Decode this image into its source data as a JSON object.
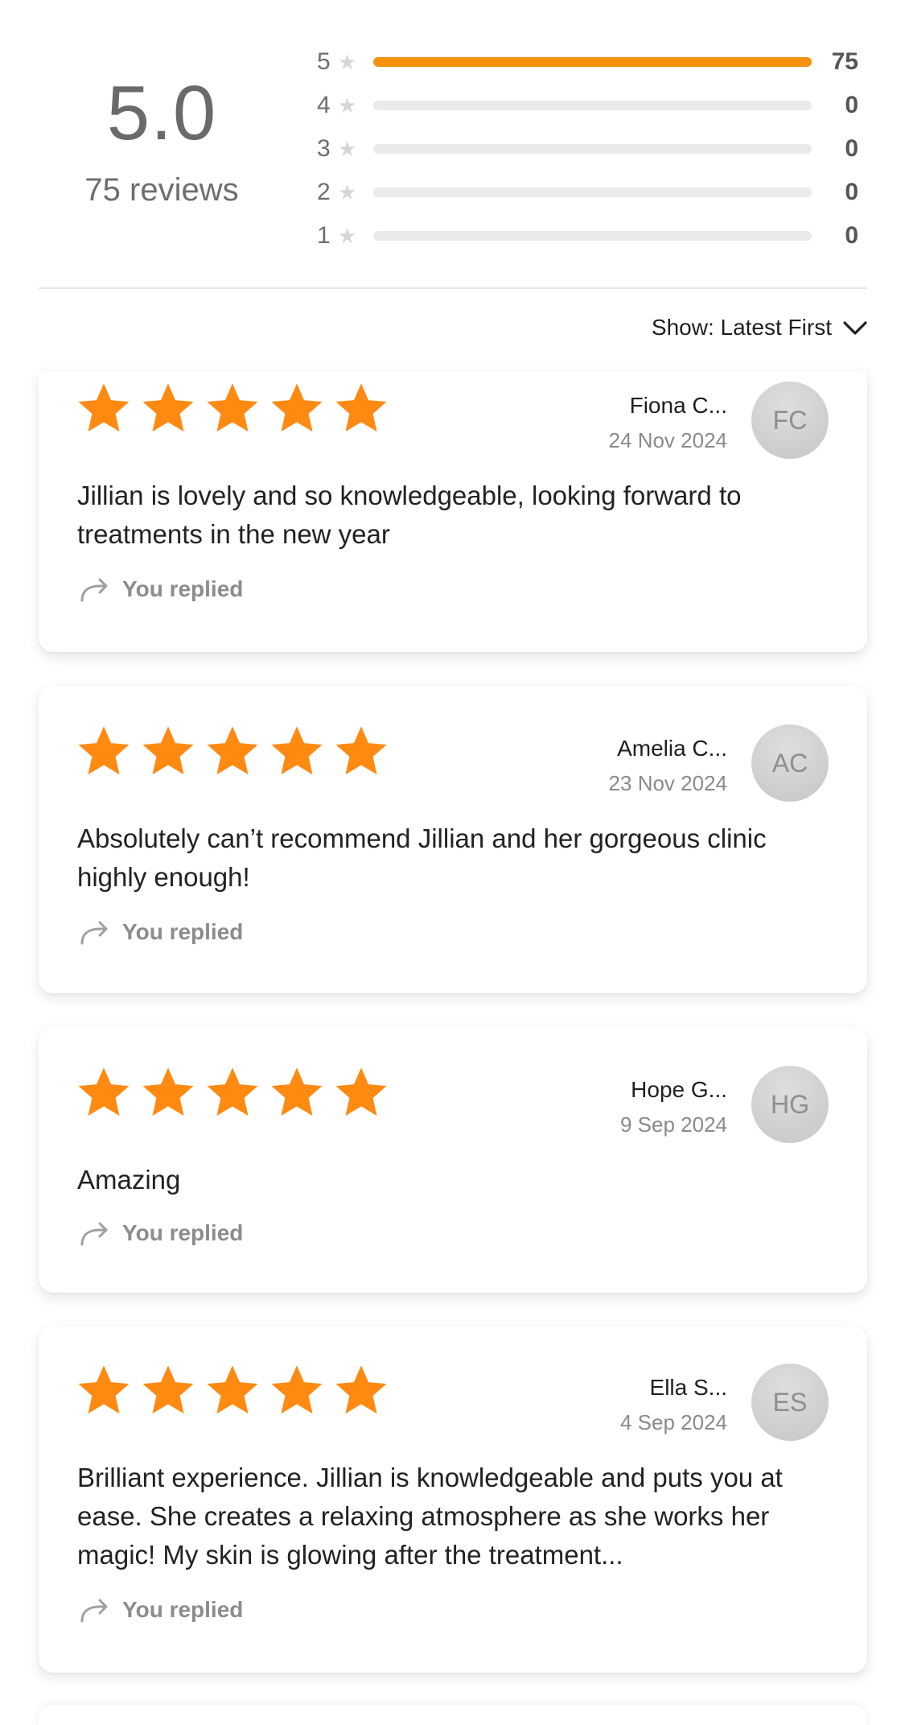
{
  "summary": {
    "average": "5.0",
    "review_count": "75 reviews",
    "bars": [
      {
        "level": "5",
        "count": "75",
        "fraction": 1.0
      },
      {
        "level": "4",
        "count": "0",
        "fraction": 0
      },
      {
        "level": "3",
        "count": "0",
        "fraction": 0
      },
      {
        "level": "2",
        "count": "0",
        "fraction": 0
      },
      {
        "level": "1",
        "count": "0",
        "fraction": 0
      }
    ]
  },
  "sort": {
    "label": "Show: Latest First"
  },
  "colors": {
    "accent": "#f5910f",
    "star": "#ff8a12",
    "track": "#eaeaea"
  },
  "reviews": [
    {
      "rating": 5,
      "name": "Fiona C...",
      "date": "24 Nov 2024",
      "initials": "FC",
      "text": "Jillian is lovely and so knowledgeable, looking forward to treatments in the new year",
      "reply_label": "You replied"
    },
    {
      "rating": 5,
      "name": "Amelia C...",
      "date": "23 Nov 2024",
      "initials": "AC",
      "text": "Absolutely can’t recommend Jillian and her gorgeous clinic highly enough!",
      "reply_label": "You replied"
    },
    {
      "rating": 5,
      "name": "Hope G...",
      "date": "9 Sep 2024",
      "initials": "HG",
      "text": "Amazing",
      "reply_label": "You replied"
    },
    {
      "rating": 5,
      "name": "Ella S...",
      "date": "4 Sep 2024",
      "initials": "ES",
      "text": "Brilliant experience. Jillian is knowledgeable and puts you at ease. She creates a relaxing atmosphere as she works her magic! My skin is glowing after the treatment...",
      "reply_label": "You replied"
    }
  ]
}
